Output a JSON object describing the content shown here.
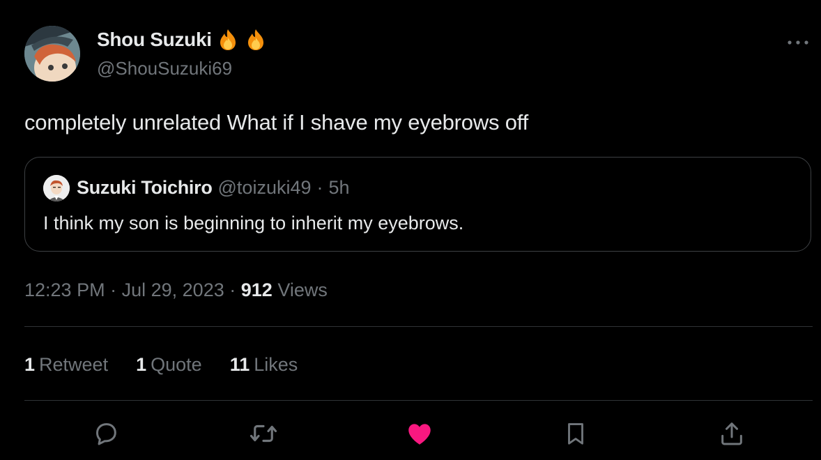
{
  "author": {
    "display_name": "Shou Suzuki",
    "handle": "@ShouSuzuki69",
    "badges": [
      "fire-emoji",
      "fire-emoji"
    ]
  },
  "more_icon": "more-horizontal-icon",
  "tweet": {
    "text": "completely unrelated What if I shave my eyebrows off"
  },
  "quoted_tweet": {
    "display_name": "Suzuki Toichiro",
    "handle": "@toizuki49",
    "separator": "·",
    "time": "5h",
    "text": "I think my son is beginning to inherit my eyebrows."
  },
  "meta": {
    "time": "12:23 PM",
    "separator": "·",
    "date": "Jul 29, 2023",
    "views_count": "912",
    "views_label": "Views"
  },
  "stats": {
    "retweets": {
      "count": "1",
      "label": "Retweet"
    },
    "quotes": {
      "count": "1",
      "label": "Quote"
    },
    "likes": {
      "count": "11",
      "label": "Likes"
    }
  },
  "actions": [
    "reply-icon",
    "retweet-icon",
    "like-icon",
    "bookmark-icon",
    "share-icon"
  ],
  "colors": {
    "background": "#000000",
    "text_primary": "#e7e9ea",
    "text_secondary": "#71767b",
    "like_active": "#f91880",
    "border": "#2f3336"
  }
}
